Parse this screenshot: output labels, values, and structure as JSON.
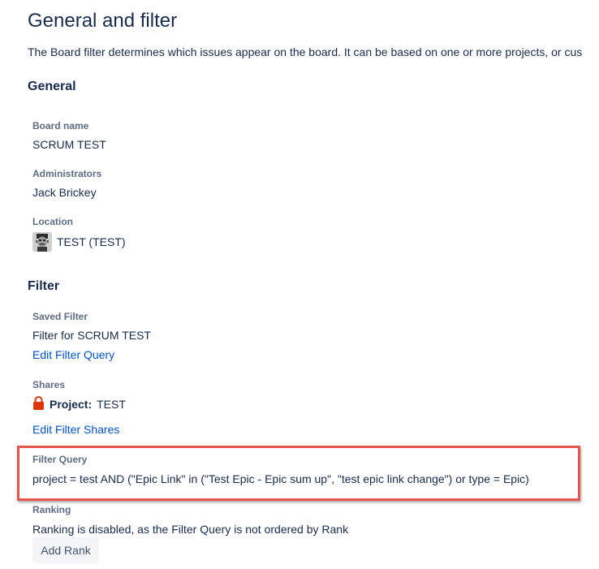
{
  "header": {
    "title": "General and filter",
    "description": "The Board filter determines which issues appear on the board. It can be based on one or more projects, or cus"
  },
  "general": {
    "heading": "General",
    "board_name_label": "Board name",
    "board_name_value": "SCRUM TEST",
    "administrators_label": "Administrators",
    "administrators_value": "Jack Brickey",
    "location_label": "Location",
    "location_value": "TEST (TEST)"
  },
  "filter": {
    "heading": "Filter",
    "saved_filter_label": "Saved Filter",
    "saved_filter_value": "Filter for SCRUM TEST",
    "edit_query_link": "Edit Filter Query",
    "shares_label": "Shares",
    "shares_type": "Project:",
    "shares_value": "TEST",
    "edit_shares_link": "Edit Filter Shares",
    "query_label": "Filter Query",
    "query_value": "project = test AND (\"Epic Link\" in (\"Test Epic - Epic sum up\", \"test epic link change\") or type = Epic)",
    "ranking_label": "Ranking",
    "ranking_value": "Ranking is disabled, as the Filter Query is not ordered by Rank",
    "add_rank_button": "Add Rank"
  },
  "colors": {
    "link": "#0052cc",
    "label": "#5e6c84",
    "text": "#172b4d",
    "highlight": "#e5564d",
    "lock": "#de350b"
  },
  "icons": {
    "location_avatar": "project-avatar-icon",
    "shares": "lock-icon"
  }
}
